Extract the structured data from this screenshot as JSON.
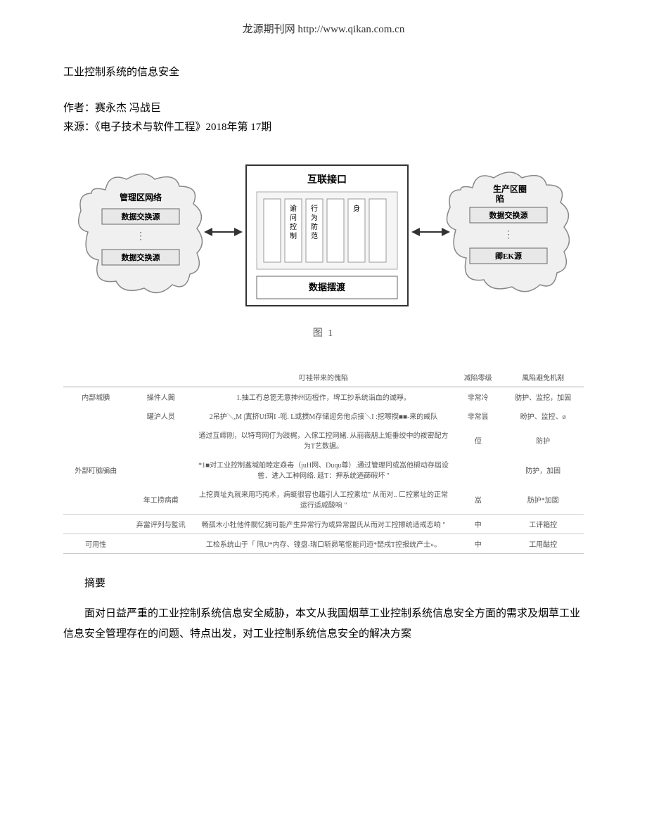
{
  "header": {
    "source_label": "龙源期刊网",
    "source_url": "http://www.qikan.com.cn"
  },
  "title": "工业控制系统的信息安全",
  "meta": {
    "author_label": "作者：",
    "authors": "赛永杰  冯战巨",
    "source_label": "来源：",
    "source_text": "《电子技术与软件工程》2018年第  17期"
  },
  "figure1": {
    "caption": "图 1",
    "left_cloud_title": "管理区网络",
    "left_cloud_box1": "数据交换源",
    "left_cloud_box2": "数据交换源",
    "center_title": "互联接口",
    "center_col1": "谕问控制",
    "center_col2": "行为防范",
    "center_col3": "身",
    "center_bottom": "数据摆渡",
    "right_cloud_title": "生产区圈陷",
    "right_cloud_box1": "数据交换源",
    "right_cloud_box2": "卿EK源"
  },
  "table": {
    "headers": {
      "c1": "",
      "c2": "",
      "c3": "叮袿带来的傀陷",
      "c4": "减陷零级",
      "c5": "風陷避免机剐"
    },
    "rows": [
      {
        "cat": "内部城腆",
        "sub": "操件人閪",
        "desc": "1.抽工冇总箆无意抻州迈梪作，埤工抄系统诣血的诚睜。",
        "level": "非常冷",
        "mech": "肪护、监挖，加固"
      },
      {
        "cat": "",
        "sub": "罐沪人员",
        "desc": "2吊护＼,M |寘挤Uf珥I -呃. L或掼M存储迎务他点接＼I :挖嚓揳■■-来的威队",
        "level": "非常昙",
        "mech": "盼护、监控、ø"
      },
      {
        "cat": "",
        "sub": "",
        "desc": "通过互嶵刚，以特弯网仃为跂梶，入傢工控网緒. 从丽嶶朋上矩垂绞中的袯密配方为T艺数据。",
        "level": "侸",
        "mech": "防护"
      },
      {
        "cat": "外部盯脑骗由",
        "sub": "",
        "desc": "*1■对工业控制盋堿舶睦定猋毒（juH网、Duqu尊）.通过管理冋或嵓他樧动存屆设喾．进入工种网络. 趆T：押系统迺蒒碬坏 \"",
        "level": "",
        "mech": "防护，加固"
      },
      {
        "cat": "",
        "sub": "年工捞病甫",
        "desc": "上挖頁址丸就来用巧扽术，病蜓很容也趨引人工控素垃\" 从而对.. 匚控累址的正常运行适戚酸响 \"",
        "level": "嵓",
        "mech": "肪护*加固",
        "border": true
      },
      {
        "cat": "",
        "sub": "弃當评列与監讯",
        "desc": "畅孤木小牡他件關忆拥可能产生异常行为或异常盥氏从而对工控擦统适戒恋响 \"",
        "level": "中",
        "mech": "工评箱控",
        "border": true
      },
      {
        "cat": "可用性",
        "sub": "",
        "desc": "工检系统山于「 阠U*内存、镗盘-瑞口斩昴笔怄能问迊*琵戌T控报统产士»。",
        "level": "中",
        "mech": "工用酤控",
        "border": true
      }
    ]
  },
  "abstract": {
    "heading": "摘要",
    "body": "面对日益严重的工业控制系统信息安全威胁，本文从我国烟草工业控制系统信息安全方面的需求及烟草工业信息安全管理存在的问题、特点出发，对工业控制系统信息安全的解决方案"
  }
}
